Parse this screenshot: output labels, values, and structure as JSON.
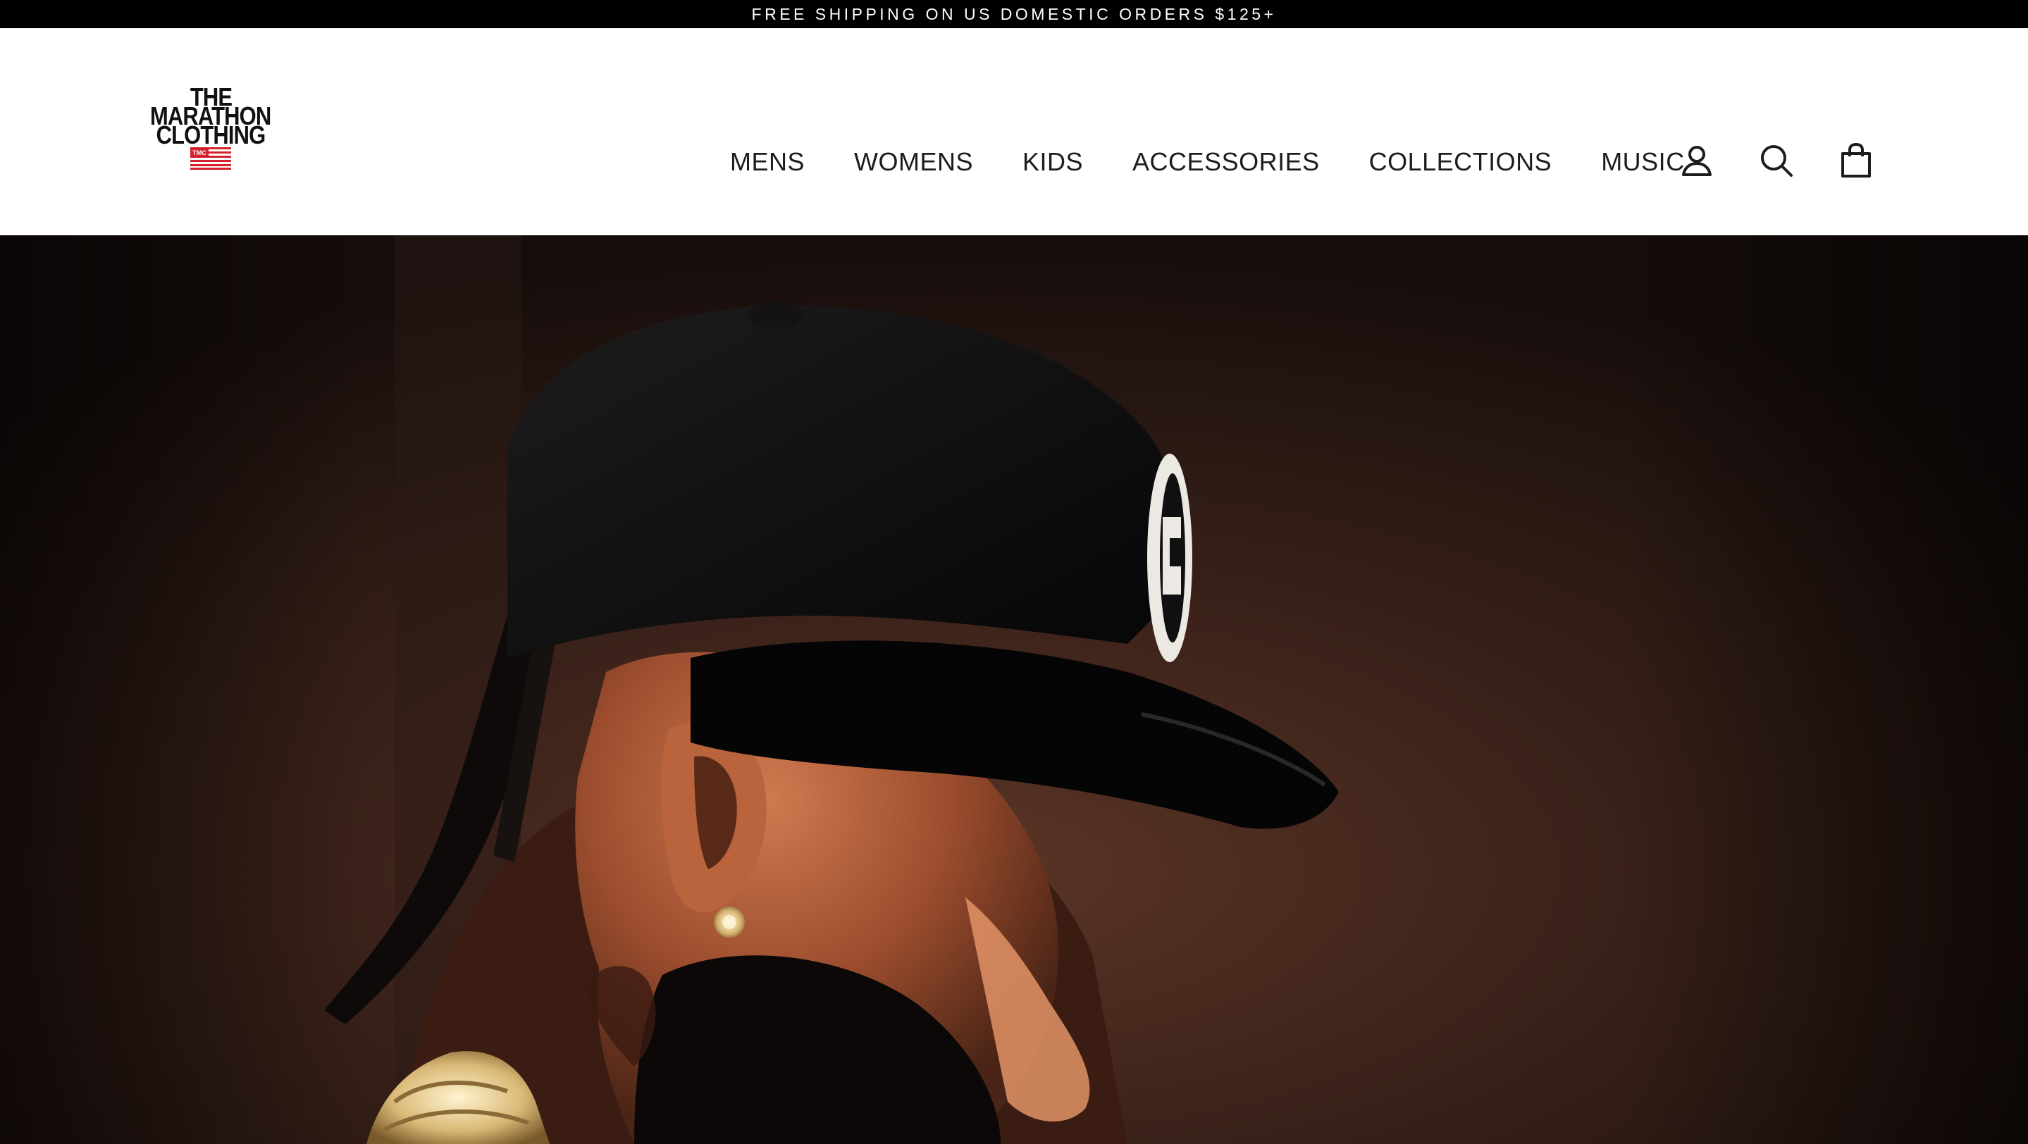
{
  "announcement": {
    "text": "FREE SHIPPING ON US DOMESTIC ORDERS $125+"
  },
  "logo": {
    "line1": "THE",
    "line2": "MARATHON",
    "line3": "CLOTHING",
    "flag_text": "TMC"
  },
  "nav": {
    "items": [
      {
        "label": "MENS"
      },
      {
        "label": "WOMENS"
      },
      {
        "label": "KIDS"
      },
      {
        "label": "ACCESSORIES"
      },
      {
        "label": "COLLECTIONS"
      },
      {
        "label": "MUSIC"
      }
    ]
  },
  "icons": {
    "account": "user-icon",
    "search": "search-icon",
    "cart": "shopping-bag-icon"
  },
  "colors": {
    "announcement_bg": "#000000",
    "announcement_text": "#ffffff",
    "nav_text": "#1c1d1d",
    "flag_red": "#d3222b",
    "hero_bg": "#1e1412"
  },
  "hero": {
    "image": "photo-man-black-cap-profile"
  }
}
